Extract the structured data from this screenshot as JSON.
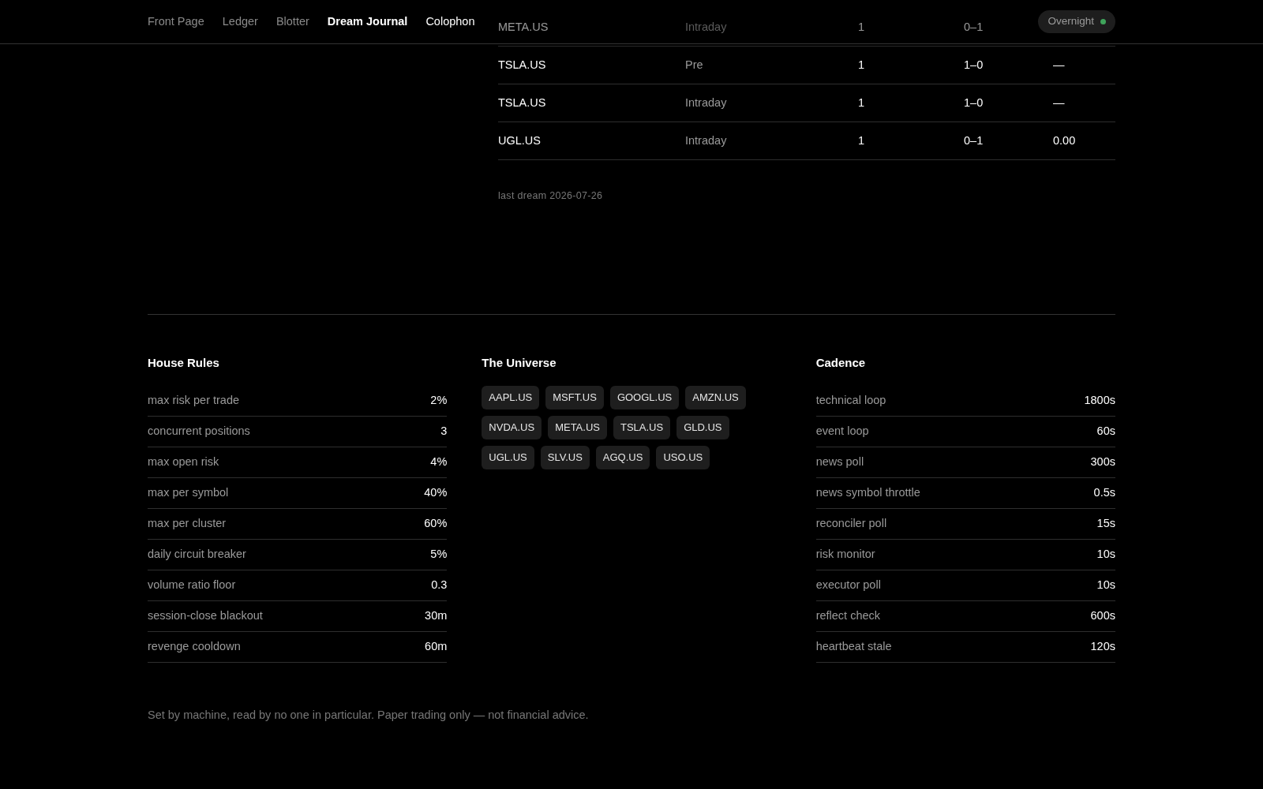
{
  "nav": {
    "items": [
      {
        "label": "Front Page",
        "selected": false,
        "bright": false
      },
      {
        "label": "Ledger",
        "selected": false,
        "bright": false
      },
      {
        "label": "Blotter",
        "selected": false,
        "bright": false
      },
      {
        "label": "Dream Journal",
        "selected": true,
        "bright": true
      },
      {
        "label": "Colophon",
        "selected": false,
        "bright": true
      }
    ],
    "status": {
      "label": "Overnight",
      "color": "#3fa45b"
    }
  },
  "table": {
    "rows": [
      {
        "cells": [
          "META.US",
          "Intraday",
          "1",
          "0–1"
        ],
        "under_header": true
      },
      {
        "cells": [
          "TSLA.US",
          "Pre",
          "1",
          "1–0",
          "—"
        ],
        "under_header": false
      },
      {
        "cells": [
          "TSLA.US",
          "Intraday",
          "1",
          "1–0",
          "—"
        ],
        "under_header": false
      },
      {
        "cells": [
          "UGL.US",
          "Intraday",
          "1",
          "0–1",
          "0.00"
        ],
        "under_header": false
      }
    ],
    "note": "last dream 2026-07-26"
  },
  "house_rules": {
    "title": "House Rules",
    "rows": [
      {
        "label": "max risk per trade",
        "value": "2%"
      },
      {
        "label": "concurrent positions",
        "value": "3"
      },
      {
        "label": "max open risk",
        "value": "4%"
      },
      {
        "label": "max per symbol",
        "value": "40%"
      },
      {
        "label": "max per cluster",
        "value": "60%"
      },
      {
        "label": "daily circuit breaker",
        "value": "5%"
      },
      {
        "label": "volume ratio floor",
        "value": "0.3"
      },
      {
        "label": "session-close blackout",
        "value": "30m"
      },
      {
        "label": "revenge cooldown",
        "value": "60m"
      }
    ]
  },
  "universe": {
    "title": "The Universe",
    "symbols": [
      "AAPL.US",
      "MSFT.US",
      "GOOGL.US",
      "AMZN.US",
      "NVDA.US",
      "META.US",
      "TSLA.US",
      "GLD.US",
      "UGL.US",
      "SLV.US",
      "AGQ.US",
      "USO.US"
    ]
  },
  "cadence": {
    "title": "Cadence",
    "rows": [
      {
        "label": "technical loop",
        "value": "1800s"
      },
      {
        "label": "event loop",
        "value": "60s"
      },
      {
        "label": "news poll",
        "value": "300s"
      },
      {
        "label": "news symbol throttle",
        "value": "0.5s"
      },
      {
        "label": "reconciler poll",
        "value": "15s"
      },
      {
        "label": "risk monitor",
        "value": "10s"
      },
      {
        "label": "executor poll",
        "value": "10s"
      },
      {
        "label": "reflect check",
        "value": "600s"
      },
      {
        "label": "heartbeat stale",
        "value": "120s"
      }
    ]
  },
  "footer": "Set by machine, read by no one in particular. Paper trading only — not financial advice."
}
